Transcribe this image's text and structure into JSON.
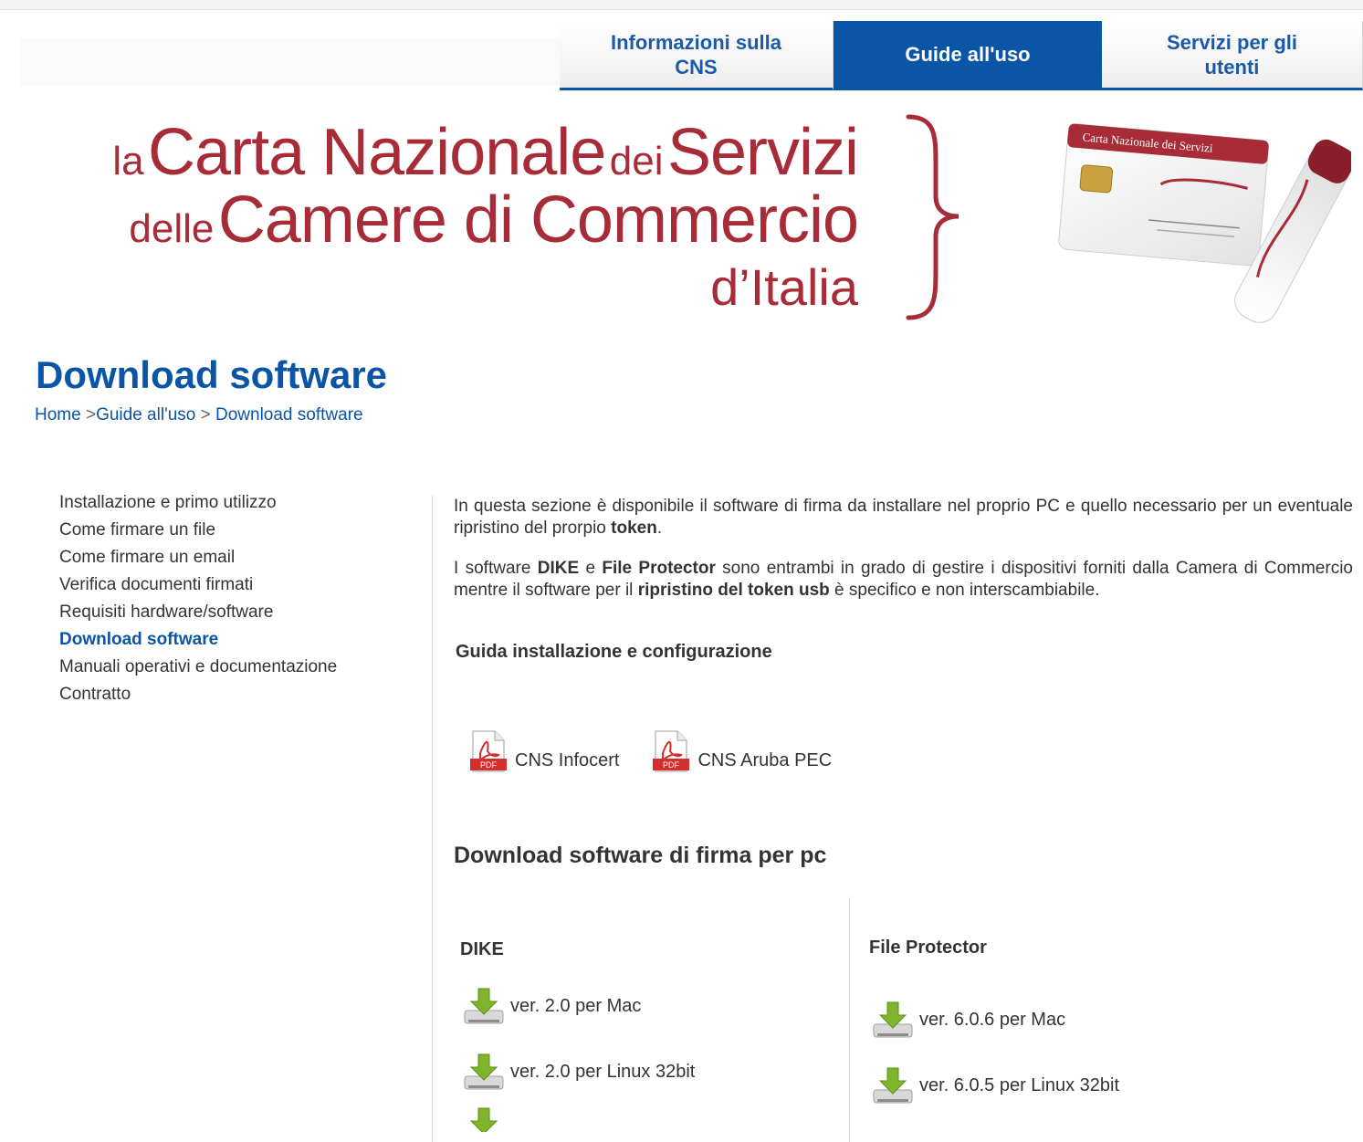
{
  "tabs": [
    {
      "label_line1": "Informazioni sulla",
      "label_line2": "CNS"
    },
    {
      "label_line1": "Guide all'uso",
      "label_line2": ""
    },
    {
      "label_line1": "Servizi per gli",
      "label_line2": "utenti"
    }
  ],
  "banner": {
    "word1": "la",
    "word2": "Carta Nazionale",
    "word3": "dei",
    "word4": "Servizi",
    "word5": "delle",
    "word6": "Camere di Commercio",
    "word7": "d’Italia",
    "card_label": "Carta Nazionale dei Servizi",
    "accent_color": "#a82c38"
  },
  "page": {
    "title": "Download software",
    "breadcrumb": [
      "Home",
      "Guide all'uso",
      "Download software"
    ],
    "breadcrumb_separator": ">"
  },
  "sidenav": {
    "items": [
      "Installazione e primo utilizzo",
      "Come firmare un file",
      "Come firmare un email",
      "Verifica documenti firmati",
      "Requisiti hardware/software",
      "Download software",
      "Manuali operativi e documentazione",
      "Contratto"
    ],
    "active": "Download software"
  },
  "main": {
    "intro_a": "In questa sezione è disponibile il software di firma da installare nel proprio PC e quello necessario per un eventuale ripristino del prorpio ",
    "intro_b": "token",
    "intro_c": ".",
    "p2_a": "I software ",
    "p2_b": "DIKE",
    "p2_c": " e ",
    "p2_d": "File Protector",
    "p2_e": " sono entrambi in grado di gestire i dispositivi forniti dalla Camera di Commercio mentre il software per il ",
    "p2_f": "ripristino del token usb",
    "p2_g": " è specifico e non interscambiabile.",
    "guide_heading": "Guida installazione e configurazione",
    "pdf_links": [
      "CNS Infocert",
      "CNS Aruba PEC"
    ],
    "pdf_icon_text": "PDF",
    "download_heading": "Download software di firma per pc",
    "dike": {
      "title": "DIKE",
      "items": [
        "ver. 2.0 per Mac",
        "ver. 2.0 per Linux 32bit"
      ]
    },
    "fileprotector": {
      "title": "File Protector",
      "items": [
        "ver. 6.0.6 per Mac",
        "ver. 6.0.5 per Linux 32bit"
      ]
    }
  },
  "colors": {
    "brand_blue": "#0b55a6",
    "brand_red": "#a82c38",
    "download_green": "#7fb52a"
  }
}
